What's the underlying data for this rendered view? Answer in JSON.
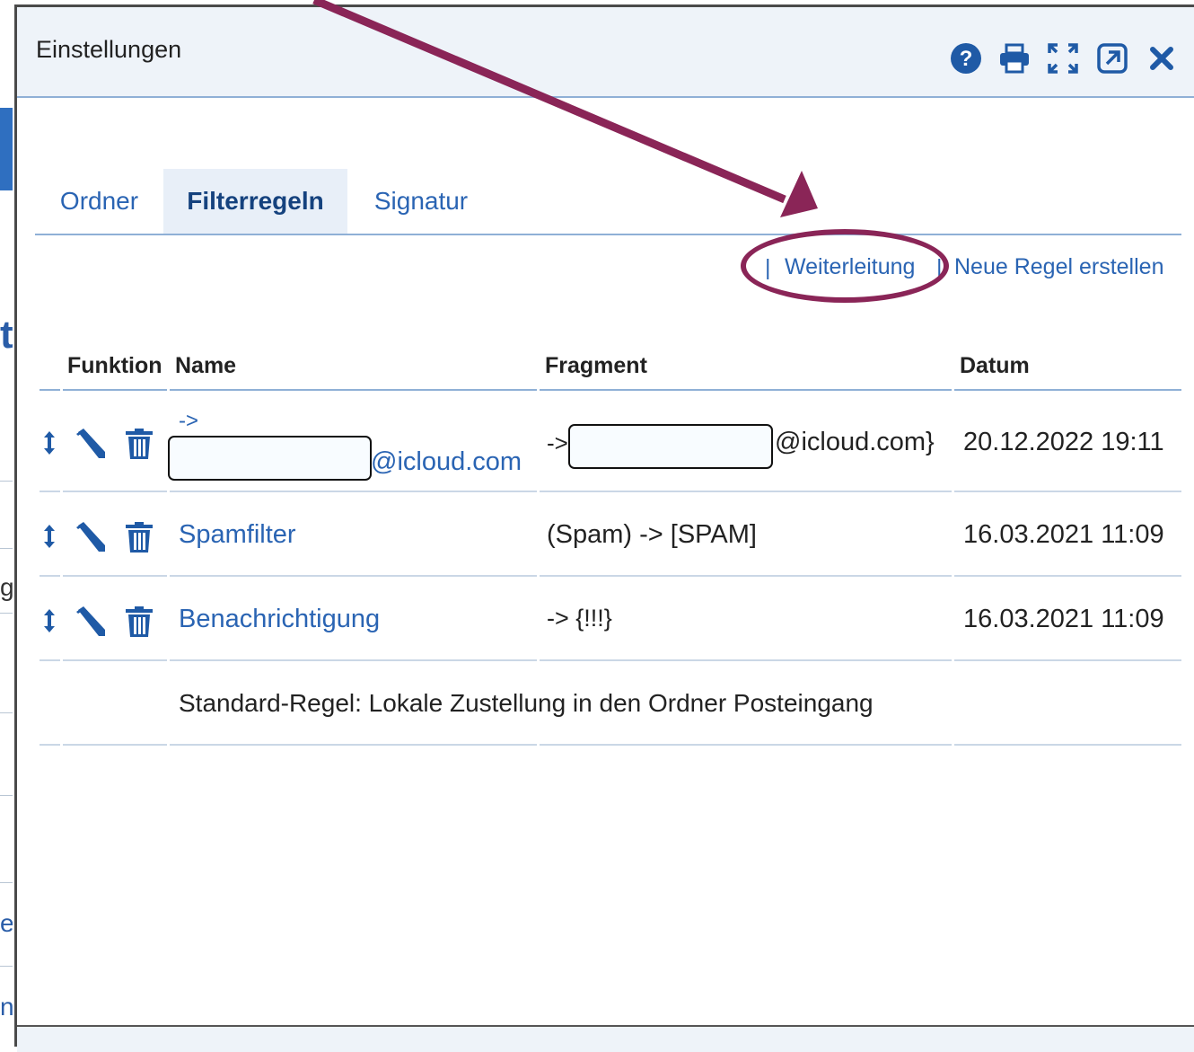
{
  "window": {
    "title": "Einstellungen"
  },
  "titlebar_icons": [
    "help-icon",
    "print-icon",
    "fullscreen-icon",
    "popout-icon",
    "close-icon"
  ],
  "tabs": [
    {
      "label": "Ordner",
      "active": false
    },
    {
      "label": "Filterregeln",
      "active": true
    },
    {
      "label": "Signatur",
      "active": false
    }
  ],
  "actions": {
    "separator": "|",
    "forward_label": "Weiterleitung",
    "new_rule_label": "Neue Regel erstellen"
  },
  "table": {
    "headers": {
      "function": "Funktion",
      "name": "Name",
      "fragment": "Fragment",
      "date": "Datum"
    },
    "rows": [
      {
        "name_prefix": "->",
        "name_suffix": "@icloud.com",
        "fragment_prefix": "->",
        "fragment_suffix": "@icloud.com}",
        "date": "20.12.2022 19:11"
      },
      {
        "name": "Spamfilter",
        "fragment": "(Spam) -> [SPAM]",
        "date": "16.03.2021 11:09"
      },
      {
        "name": "Benachrichtigung",
        "fragment": "-> {!!!}",
        "date": "16.03.2021 11:09"
      }
    ],
    "default_rule": "Standard-Regel: Lokale Zustellung in den Ordner Posteingang"
  },
  "colors": {
    "accent": "#2a64b3",
    "annotation": "#8a2557",
    "header_bg": "#eef3f9"
  }
}
